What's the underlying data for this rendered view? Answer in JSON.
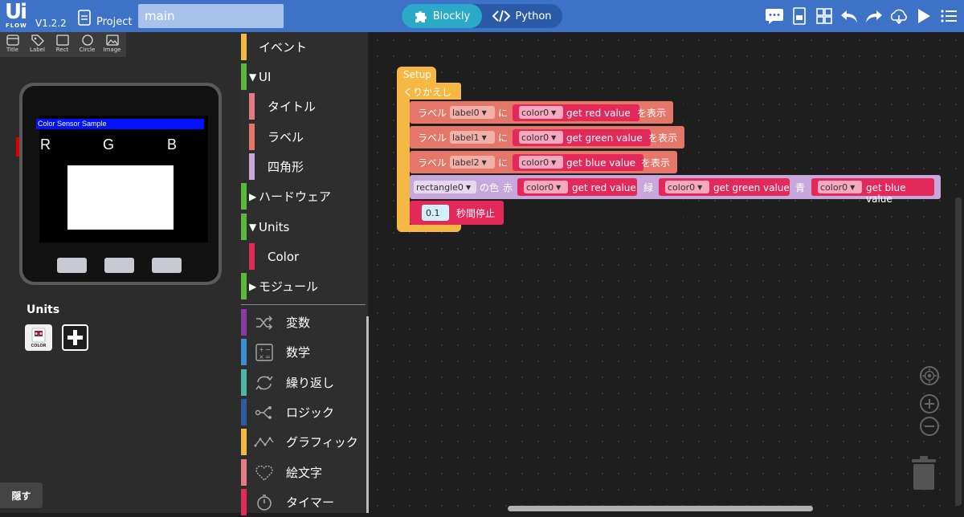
{
  "app": {
    "logo_text": "Ui",
    "logo_sub": "FLOW",
    "version": "V1.2.2",
    "project_label": "Project",
    "file_name": "main"
  },
  "mode": {
    "blockly": "Blockly",
    "python": "Python"
  },
  "widgets": [
    "Title",
    "Label",
    "Rect",
    "Circle",
    "Image"
  ],
  "device_screen": {
    "title": "Color Sensor Sample",
    "letters": [
      "R",
      "G",
      "B"
    ]
  },
  "units": {
    "title": "Units",
    "color_badge": "COLOR"
  },
  "hide_button": "隠す",
  "toolbox": {
    "items": [
      {
        "label": "イベント",
        "color": "#f5b845",
        "indent": false,
        "arrow": ""
      },
      {
        "label": "UI",
        "color": "#5cb83c",
        "indent": false,
        "arrow": "▼"
      },
      {
        "label": "タイトル",
        "color": "#e57a86",
        "indent": true,
        "arrow": ""
      },
      {
        "label": "ラベル",
        "color": "#e5766a",
        "indent": true,
        "arrow": ""
      },
      {
        "label": "四角形",
        "color": "#c8a8da",
        "indent": true,
        "arrow": ""
      },
      {
        "label": "ハードウェア",
        "color": "#5cb83c",
        "indent": false,
        "arrow": "▶"
      },
      {
        "label": "Units",
        "color": "#5cb83c",
        "indent": false,
        "arrow": "▼"
      },
      {
        "label": "Color",
        "color": "#e3285a",
        "indent": true,
        "arrow": ""
      },
      {
        "label": "モジュール",
        "color": "#5cb83c",
        "indent": false,
        "arrow": "▶"
      }
    ],
    "categories": [
      {
        "label": "変数",
        "color": "#8a3aa0",
        "icon": "shuffle-icon"
      },
      {
        "label": "数学",
        "color": "#3b8ed0",
        "icon": "calculator-icon"
      },
      {
        "label": "繰り返し",
        "color": "#4fb5a5",
        "icon": "loop-icon"
      },
      {
        "label": "ロジック",
        "color": "#2e5aa0",
        "icon": "logic-icon"
      },
      {
        "label": "グラフィック",
        "color": "#f5b845",
        "icon": "graphic-icon"
      },
      {
        "label": "絵文字",
        "color": "#e57a86",
        "icon": "heart-icon"
      },
      {
        "label": "タイマー",
        "color": "#e3285a",
        "icon": "timer-icon"
      }
    ]
  },
  "blocks": {
    "setup": "Setup",
    "loop": "くりかえし",
    "label_prefix": "ラベル",
    "ni": "に",
    "show": "を表示",
    "rows": [
      {
        "label": "label0",
        "color_var": "color0",
        "method": "get red value"
      },
      {
        "label": "label1",
        "color_var": "color0",
        "method": "get green value"
      },
      {
        "label": "label2",
        "color_var": "color0",
        "method": "get blue value"
      }
    ],
    "rect": {
      "name": "rectangle0",
      "color_text": "の色",
      "red": "赤",
      "green": "緑",
      "blue": "青",
      "red_method": "get red value",
      "green_method": "get green value",
      "blue_method": "get blue value",
      "color_var": "color0"
    },
    "wait": {
      "value": "0.1",
      "text": "秒間停止"
    }
  },
  "colors": {
    "topbar": "#3d72c6",
    "event": "#f5b845",
    "label_block": "#e5766a",
    "color_block": "#e3285a",
    "rect_block": "#c8a8da",
    "timer_block": "#e3285a"
  }
}
